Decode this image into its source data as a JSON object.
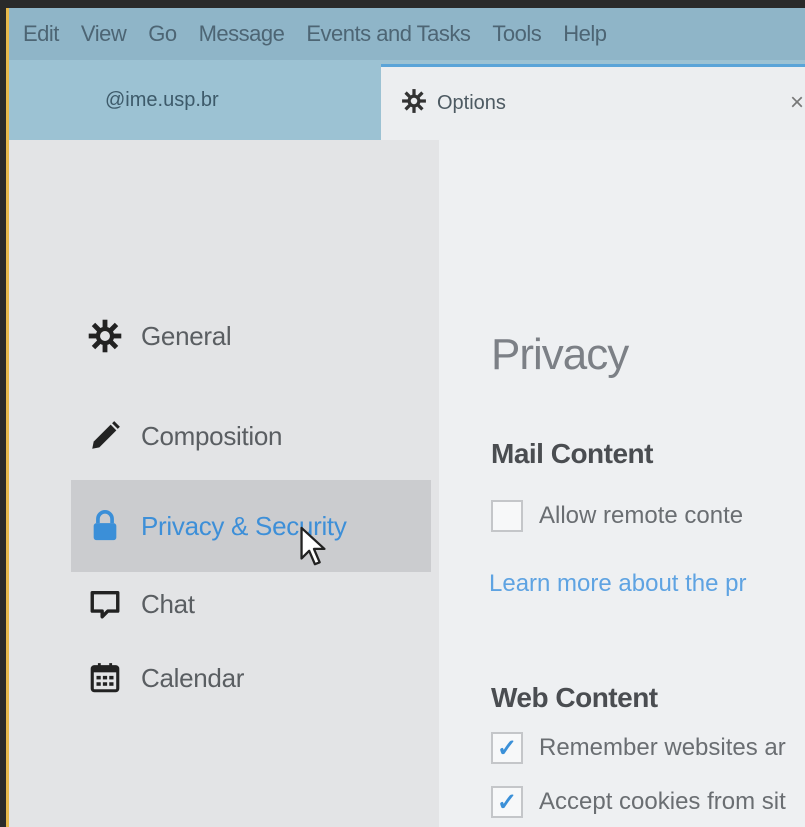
{
  "menubar": {
    "items": [
      "Edit",
      "View",
      "Go",
      "Message",
      "Events and Tasks",
      "Tools",
      "Help"
    ]
  },
  "tabs": {
    "account_label": "@ime.usp.br",
    "options_label": "Options",
    "close_symbol": "×"
  },
  "sidebar": {
    "items": [
      {
        "label": "General",
        "icon": "gear-icon"
      },
      {
        "label": "Composition",
        "icon": "pencil-icon"
      },
      {
        "label": "Privacy & Security",
        "icon": "lock-icon",
        "active": true
      },
      {
        "label": "Chat",
        "icon": "chat-bubble-icon"
      },
      {
        "label": "Calendar",
        "icon": "calendar-icon"
      }
    ]
  },
  "content": {
    "title": "Privacy",
    "mail_section": "Mail Content",
    "remote_content_label": "Allow remote conte",
    "learn_more_link": "Learn more about the pr",
    "web_section": "Web Content",
    "remember_label": "Remember websites ar",
    "cookies_label": "Accept cookies from sit",
    "checkmark": "✓"
  },
  "colors": {
    "accent": "#3d8fd8",
    "tabbar": "#9cc2d3",
    "menubar": "#8fb5c8"
  }
}
